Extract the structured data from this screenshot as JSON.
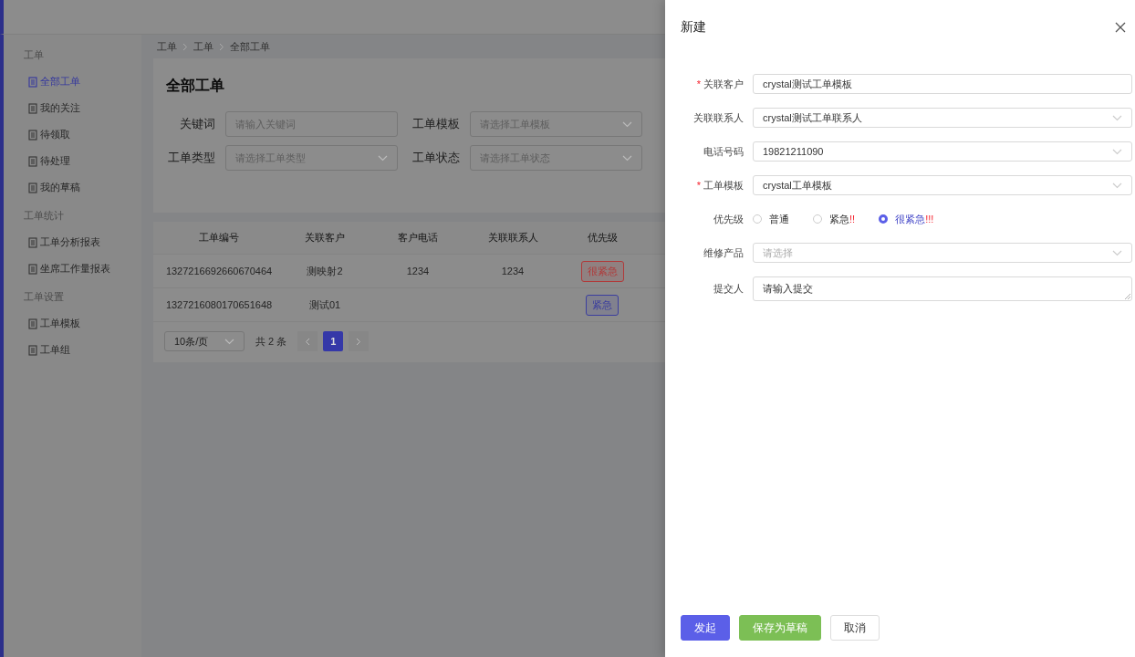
{
  "sidebar": {
    "groups": [
      {
        "title": "工单",
        "items": [
          {
            "label": "全部工单",
            "selected": true
          },
          {
            "label": "我的关注",
            "selected": false
          },
          {
            "label": "待领取",
            "selected": false
          },
          {
            "label": "待处理",
            "selected": false
          },
          {
            "label": "我的草稿",
            "selected": false
          }
        ]
      },
      {
        "title": "工单统计",
        "items": [
          {
            "label": "工单分析报表",
            "selected": false
          },
          {
            "label": "坐席工作量报表",
            "selected": false
          }
        ]
      },
      {
        "title": "工单设置",
        "items": [
          {
            "label": "工单模板",
            "selected": false
          },
          {
            "label": "工单组",
            "selected": false
          }
        ]
      }
    ]
  },
  "breadcrumb": [
    "工单",
    "工单",
    "全部工单"
  ],
  "page_title": "全部工单",
  "filters": [
    {
      "label": "关键词",
      "placeholder": "请输入关键词",
      "kind": "input"
    },
    {
      "label": "工单模板",
      "placeholder": "请选择工单模板",
      "kind": "select"
    },
    {
      "label": "工单类型",
      "placeholder": "请选择工单类型",
      "kind": "select"
    },
    {
      "label": "工单状态",
      "placeholder": "请选择工单状态",
      "kind": "select"
    }
  ],
  "table": {
    "columns": [
      "工单编号",
      "关联客户",
      "客户电话",
      "关联联系人",
      "优先级"
    ],
    "rows": [
      {
        "id": "1327216692660670464",
        "customer": "测映射2",
        "phone": "1234",
        "contact": "1234",
        "priority": {
          "label": "很紧急",
          "color": "#b03a3a"
        }
      },
      {
        "id": "1327216080170651648",
        "customer": "测试01",
        "priority": {
          "label": "紧急",
          "color": "#3b3e9e"
        }
      }
    ]
  },
  "pagination": {
    "page_size": "10条/页",
    "total": "共 2 条",
    "pages": [
      {
        "label": "1",
        "selected": true
      }
    ]
  },
  "drawer": {
    "title": "新建",
    "fields": [
      {
        "label": "关联客户",
        "required_mark": "*",
        "kind": "input",
        "value": "crystal测试工单模板"
      },
      {
        "label": "关联联系人",
        "kind": "select",
        "value": "crystal测试工单联系人"
      },
      {
        "label": "电话号码",
        "kind": "select",
        "value": "19821211090"
      },
      {
        "label": "工单模板",
        "required_mark": "*",
        "kind": "select",
        "value": "crystal工单模板"
      },
      {
        "label": "优先级",
        "kind": "radio",
        "options": [
          {
            "label": "普通",
            "selected": false
          },
          {
            "label": "紧急",
            "marks": "!!",
            "selected": false
          },
          {
            "label": "很紧急",
            "marks": "!!!",
            "selected": true
          }
        ]
      },
      {
        "label": "维修产品",
        "kind": "select",
        "placeholder": "请选择"
      },
      {
        "label": "提交人",
        "kind": "textarea",
        "value": "请输入提交"
      }
    ],
    "buttons": [
      {
        "label": "发起",
        "kind": "primary"
      },
      {
        "label": "保存为草稿",
        "kind": "success"
      },
      {
        "label": "取消",
        "kind": "default"
      }
    ]
  }
}
